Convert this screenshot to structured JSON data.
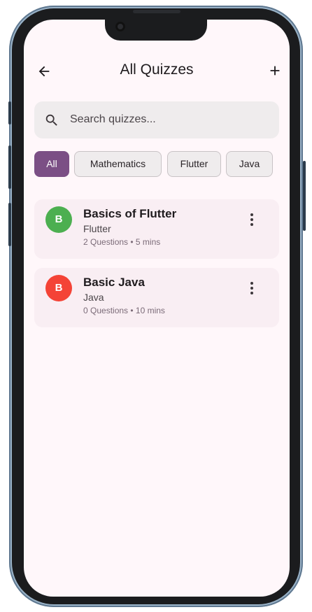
{
  "header": {
    "title": "All Quizzes"
  },
  "search": {
    "placeholder": "Search quizzes..."
  },
  "filters": [
    "All",
    "Mathematics",
    "Flutter",
    "Java"
  ],
  "quizzes": [
    {
      "initial": "B",
      "title": "Basics of Flutter",
      "category": "Flutter",
      "meta": "2 Questions • 5 mins",
      "color": "#4caf50"
    },
    {
      "initial": "B",
      "title": "Basic Java",
      "category": "Java",
      "meta": "0 Questions • 10 mins",
      "color": "#f44336"
    }
  ],
  "colors": {
    "accent": "#7b4f85",
    "background": "#fff7fa",
    "card": "#f9eef3"
  },
  "icons": {
    "back": "arrow-left-icon",
    "add": "plus-icon",
    "search": "search-icon",
    "more": "more-vert-icon"
  }
}
